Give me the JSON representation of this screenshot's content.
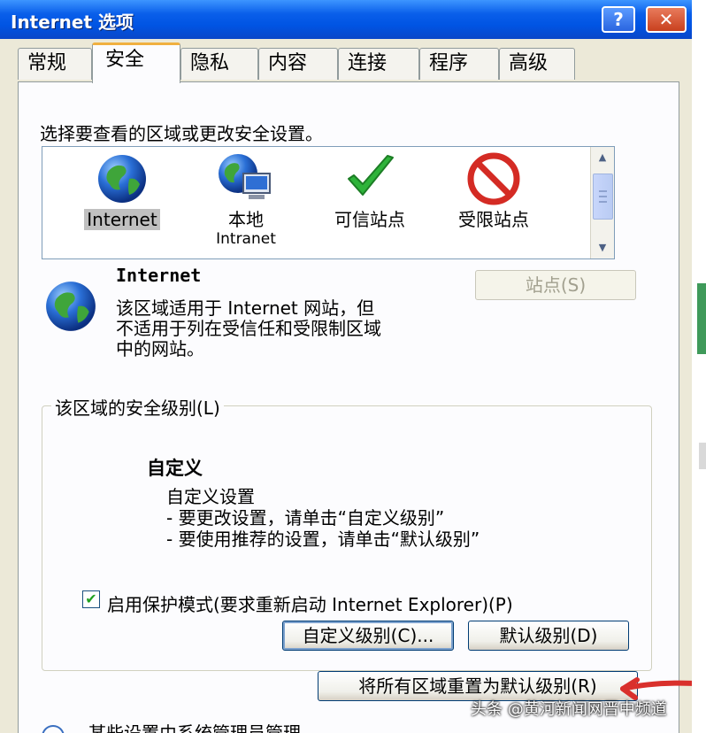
{
  "window": {
    "title": "Internet 选项",
    "help_label": "?",
    "close_label": "✕"
  },
  "tabs": [
    {
      "label": "常规"
    },
    {
      "label": "安全"
    },
    {
      "label": "隐私"
    },
    {
      "label": "内容"
    },
    {
      "label": "连接"
    },
    {
      "label": "程序"
    },
    {
      "label": "高级"
    }
  ],
  "active_tab": "安全",
  "security": {
    "instruction": "选择要查看的区域或更改安全设置。",
    "zones": [
      {
        "label": "Internet",
        "icon": "globe-icon",
        "selected": true
      },
      {
        "label": "本地",
        "sublabel": "Intranet",
        "icon": "local-intranet-icon"
      },
      {
        "label": "可信站点",
        "icon": "green-check-icon"
      },
      {
        "label": "受限站点",
        "icon": "restricted-icon"
      }
    ],
    "zone_info": {
      "name": "Internet",
      "description_lines": [
        "该区域适用于 Internet 网站，但",
        "不适用于列在受信任和受限制区域",
        "中的网站。"
      ]
    },
    "sites_button": "站点(S)",
    "level_group": {
      "title": "该区域的安全级别(L)",
      "level_name": "自定义",
      "level_desc": "自定义设置",
      "hints": [
        "- 要更改设置，请单击“自定义级别”",
        "- 要使用推荐的设置，请单击“默认级别”"
      ]
    },
    "protected_mode": {
      "checked": true,
      "label": "启用保护模式(要求重新启动 Internet Explorer)(P)"
    },
    "custom_level_button": "自定义级别(C)...",
    "default_level_button": "默认级别(D)",
    "reset_all_button": "将所有区域重置为默认级别(R)",
    "admin_note": "某些设置由系统管理员管理。"
  },
  "watermark": "头条 @黄河新闻网晋中频道",
  "colors": {
    "titlebar": "#0054e3",
    "panel": "#fcfcfe",
    "dialog": "#ece9d8",
    "tab_highlight": "#f0b040",
    "annotation_arrow": "#d9302c"
  }
}
